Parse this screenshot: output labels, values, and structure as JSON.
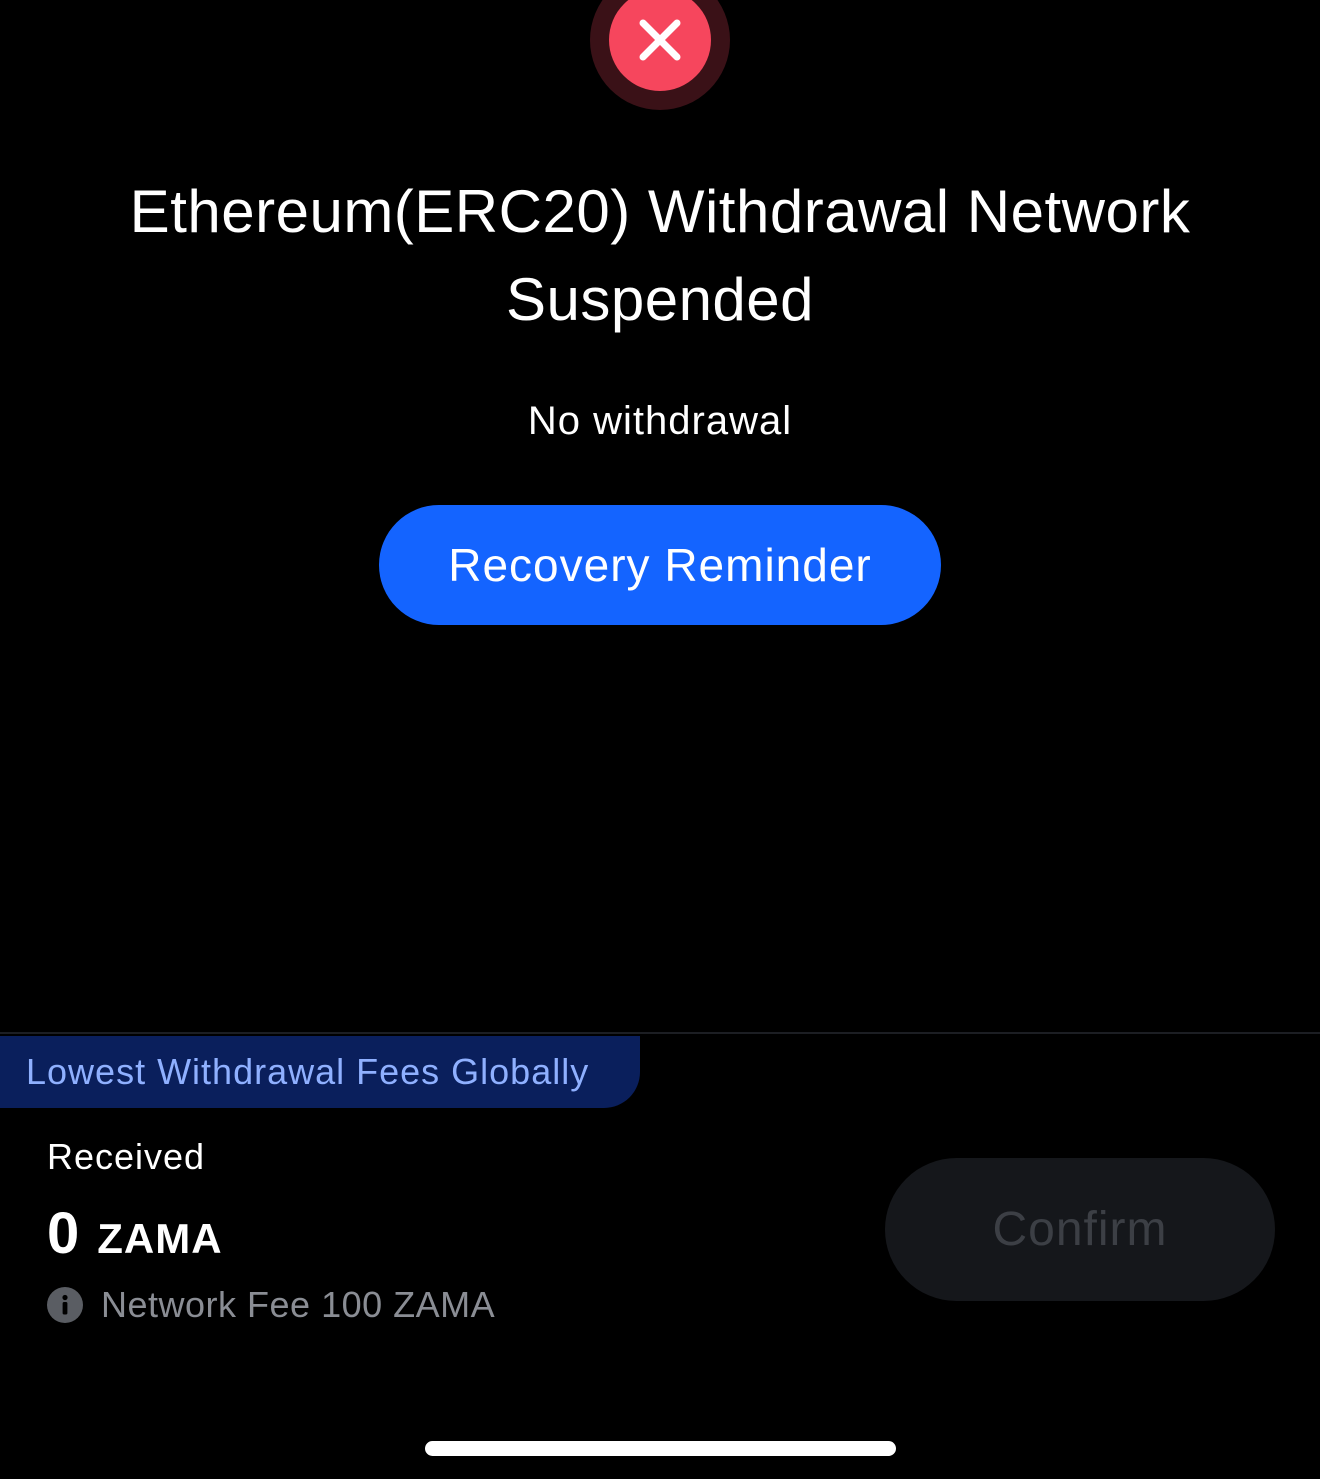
{
  "status": {
    "icon": "close-icon",
    "icon_color": "#f6465d"
  },
  "title": "Ethereum(ERC20) Withdrawal Network Suspended",
  "subtitle": "No withdrawal",
  "recovery_button": {
    "label": "Recovery Reminder",
    "color": "#1464ff"
  },
  "promo": {
    "label": "Lowest Withdrawal Fees Globally"
  },
  "summary": {
    "received_label": "Received",
    "amount": "0",
    "unit": "ZAMA",
    "fee_icon": "info-icon",
    "fee_text": "Network Fee 100 ZAMA"
  },
  "confirm_button": {
    "label": "Confirm",
    "state": "disabled"
  }
}
